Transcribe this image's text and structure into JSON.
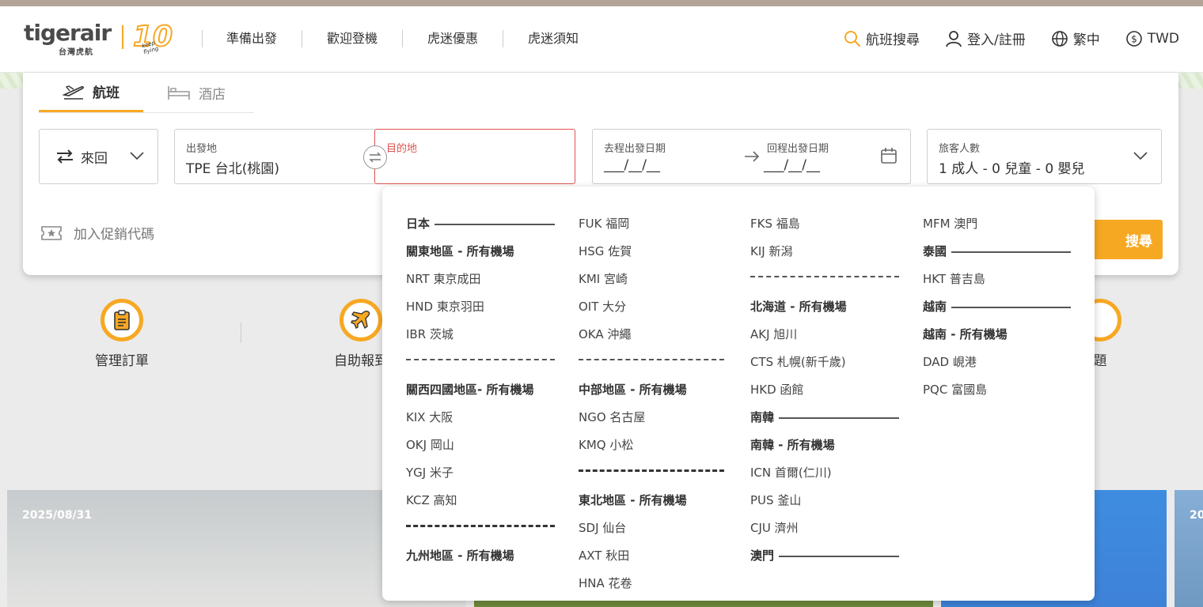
{
  "header": {
    "logo_text": "tigerair",
    "logo_sub": "台灣虎航",
    "logo_anniv": "10",
    "logo_tagline": "keep flying",
    "nav": [
      "準備出發",
      "歡迎登機",
      "虎迷優惠",
      "虎迷須知"
    ],
    "tools": {
      "flight_search": "航班搜尋",
      "login": "登入/註冊",
      "language": "繁中",
      "currency": "TWD"
    }
  },
  "tabs": {
    "flight": "航班",
    "hotel": "酒店"
  },
  "form": {
    "trip_type": "來回",
    "from_label": "出發地",
    "from_value": "TPE 台北(桃園)",
    "to_label": "目的地",
    "depart_label": "去程出發日期",
    "depart_value": "___/__/__",
    "return_label": "回程出發日期",
    "return_value": "___/__/__",
    "pax_label": "旅客人數",
    "pax_value": "1 成人 - 0 兒童 - 0 嬰兒",
    "promo": "加入促銷代碼",
    "search": "搜尋"
  },
  "quick_links": [
    {
      "label": "管理訂單"
    },
    {
      "label": "自助報到"
    },
    {
      "label": "題"
    }
  ],
  "tiles": {
    "tile1_date": "2025/08/31",
    "tile4_date": "20"
  },
  "dropdown": {
    "col1": [
      {
        "t": "country",
        "text": "日本"
      },
      {
        "t": "region",
        "text": "關東地區 - 所有機場"
      },
      {
        "t": "item",
        "text": "NRT 東京成田"
      },
      {
        "t": "item",
        "text": "HND 東京羽田"
      },
      {
        "t": "item",
        "text": "IBR 茨城"
      },
      {
        "t": "dash"
      },
      {
        "t": "region",
        "text": "關西四國地區- 所有機場"
      },
      {
        "t": "item",
        "text": "KIX 大阪"
      },
      {
        "t": "item",
        "text": "OKJ 岡山"
      },
      {
        "t": "item",
        "text": "YGJ 米子"
      },
      {
        "t": "item",
        "text": "KCZ 高知"
      },
      {
        "t": "dash-thick"
      },
      {
        "t": "region",
        "text": "九州地區 - 所有機場"
      }
    ],
    "col2": [
      {
        "t": "item",
        "text": "FUK 福岡"
      },
      {
        "t": "item",
        "text": "HSG 佐賀"
      },
      {
        "t": "item",
        "text": "KMI 宮崎"
      },
      {
        "t": "item",
        "text": "OIT 大分"
      },
      {
        "t": "item",
        "text": "OKA 沖繩"
      },
      {
        "t": "dash"
      },
      {
        "t": "region",
        "text": "中部地區 - 所有機場"
      },
      {
        "t": "item",
        "text": "NGO 名古屋"
      },
      {
        "t": "item",
        "text": "KMQ 小松"
      },
      {
        "t": "dash-thick"
      },
      {
        "t": "region",
        "text": "東北地區 - 所有機場"
      },
      {
        "t": "item",
        "text": "SDJ 仙台"
      },
      {
        "t": "item",
        "text": "AXT 秋田"
      },
      {
        "t": "item",
        "text": "HNA 花卷"
      }
    ],
    "col3": [
      {
        "t": "item",
        "text": "FKS 福島"
      },
      {
        "t": "item",
        "text": "KIJ 新潟"
      },
      {
        "t": "dash"
      },
      {
        "t": "region",
        "text": "北海道 - 所有機場"
      },
      {
        "t": "item",
        "text": "AKJ 旭川"
      },
      {
        "t": "item",
        "text": "CTS 札幌(新千歲)"
      },
      {
        "t": "item",
        "text": "HKD 函館"
      },
      {
        "t": "country",
        "text": "南韓"
      },
      {
        "t": "region",
        "text": "南韓 - 所有機場"
      },
      {
        "t": "item",
        "text": "ICN 首爾(仁川)"
      },
      {
        "t": "item",
        "text": "PUS 釜山"
      },
      {
        "t": "item",
        "text": "CJU 濟州"
      },
      {
        "t": "country",
        "text": "澳門"
      }
    ],
    "col4": [
      {
        "t": "item",
        "text": "MFM 澳門"
      },
      {
        "t": "country",
        "text": "泰國"
      },
      {
        "t": "item",
        "text": "HKT 普吉島"
      },
      {
        "t": "country",
        "text": "越南"
      },
      {
        "t": "region",
        "text": "越南 - 所有機場"
      },
      {
        "t": "item",
        "text": "DAD 峴港"
      },
      {
        "t": "item",
        "text": "PQC 富國島"
      }
    ]
  }
}
